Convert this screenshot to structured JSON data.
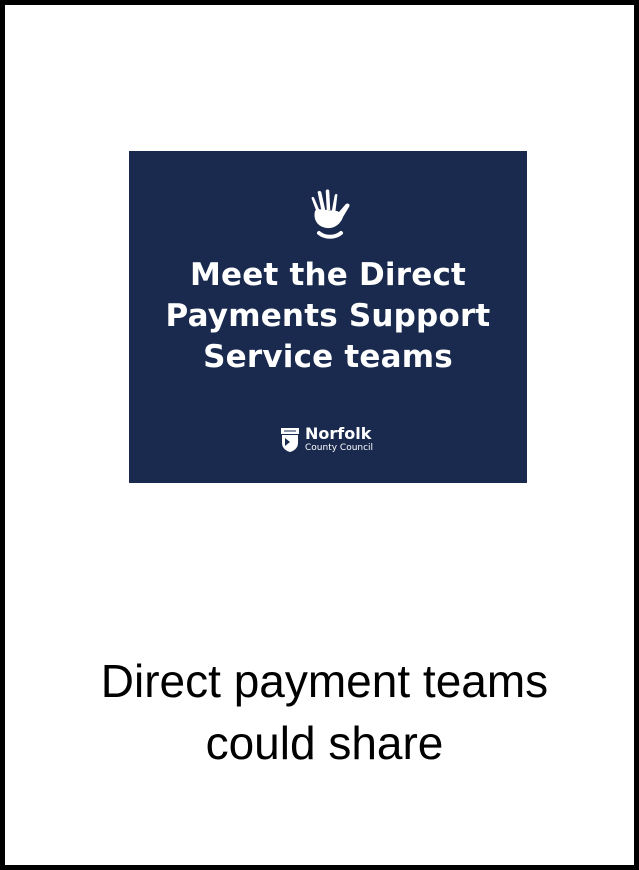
{
  "banner": {
    "title_lines": [
      "Meet the Direct",
      "Payments Support",
      "Service teams"
    ],
    "icon": "waving-hand-icon",
    "background_color": "#1a2a4f",
    "logo": {
      "name": "Norfolk",
      "subtitle": "County Council",
      "icon": "crest-icon"
    }
  },
  "caption": {
    "lines": [
      "Direct payment teams",
      "could share"
    ]
  }
}
